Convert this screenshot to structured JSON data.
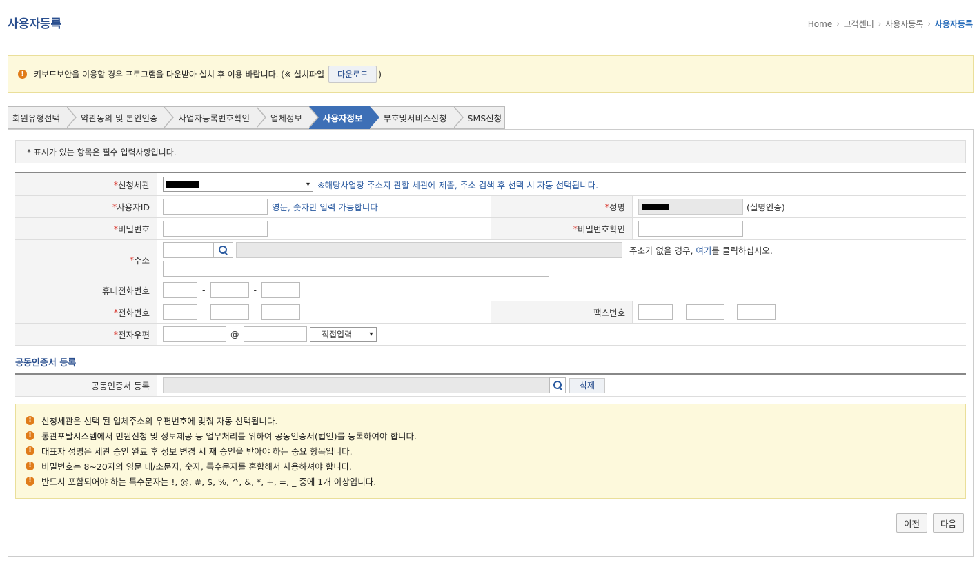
{
  "page": {
    "title": "사용자등록",
    "breadcrumb": [
      "Home",
      "고객센터",
      "사용자등록",
      "사용자등록"
    ]
  },
  "top_notice": {
    "text": "키보드보안을 이용할 경우 프로그램을 다운받아 설치 후 이용 바랍니다. (※ 설치파일",
    "download_label": "다운로드",
    "close_paren": ")"
  },
  "steps": [
    {
      "label": "회원유형선택",
      "active": false
    },
    {
      "label": "약관동의 및 본인인증",
      "active": false
    },
    {
      "label": "사업자등록번호확인",
      "active": false
    },
    {
      "label": "업체정보",
      "active": false
    },
    {
      "label": "사용자정보",
      "active": true
    },
    {
      "label": "부호및서비스신청",
      "active": false
    },
    {
      "label": "SMS신청",
      "active": false
    }
  ],
  "required_note": "* 표시가 있는 항목은 필수 입력사항입니다.",
  "form": {
    "customs": {
      "star": "*",
      "label": "신청세관",
      "hint": "※해당사업장 주소지 관할 세관에 제출, 주소 검색 후 선택 시 자동 선택됩니다."
    },
    "user_id": {
      "star": "*",
      "label": "사용자ID",
      "hint": "영문, 숫자만 입력 가능합니다"
    },
    "name": {
      "star": "*",
      "label": "성명",
      "hint": "(실명인증)"
    },
    "password": {
      "star": "*",
      "label": "비밀번호"
    },
    "password_confirm": {
      "star": "*",
      "label": "비밀번호확인"
    },
    "address": {
      "star": "*",
      "label": "주소",
      "hint_pre": "주소가 없을 경우, ",
      "hint_link": "여기",
      "hint_post": "를 클릭하십시오."
    },
    "mobile": {
      "label": "휴대전화번호",
      "sep": "-"
    },
    "phone": {
      "star": "*",
      "label": "전화번호",
      "sep": "-"
    },
    "fax": {
      "label": "팩스번호",
      "sep": "-"
    },
    "email": {
      "star": "*",
      "label": "전자우편",
      "at": "@",
      "domain_option": "-- 직접입력 --"
    }
  },
  "cert": {
    "section_title": "공동인증서 등록",
    "label": "공동인증서 등록",
    "delete_label": "삭제"
  },
  "bottom_notice": [
    "신청세관은 선택 된 업체주소의 우편번호에 맞춰 자동 선택됩니다.",
    "통관포탈시스템에서 민원신청 및 정보제공 등 업무처리를 위하여 공동인증서(법인)를 등록하여야 합니다.",
    "대표자 성명은 세관 승인 완료 후 정보 변경 시 재 승인을 받아야 하는 중요 항목입니다.",
    "비밀번호는 8~20자의 영문 대/소문자, 숫자, 특수문자를 혼합해서 사용하셔야 합니다.",
    "반드시 포함되어야 하는 특수문자는 !, @, #, $, %, ^, &, *, +, =, _ 중에 1개 이상입니다."
  ],
  "buttons": {
    "prev": "이전",
    "next": "다음"
  },
  "icons": {
    "warning": "exclamation-circle-icon",
    "search": "search-icon",
    "separator": "chevron-right-icon"
  },
  "colors": {
    "brand": "#2a4f8f",
    "active_step": "#3d6fb6",
    "required": "#d9342b",
    "notice_bg": "#fdf9dc",
    "warn": "#e07c1a"
  }
}
